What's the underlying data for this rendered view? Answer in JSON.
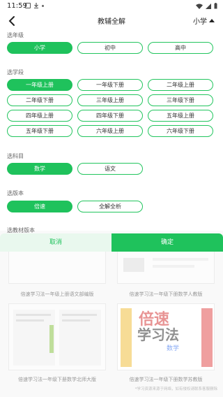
{
  "status_bar": {
    "time": "11:59"
  },
  "header": {
    "title": "教辅全解",
    "level": "小学"
  },
  "grade_section": {
    "label": "选年级",
    "options": [
      "小学",
      "初中",
      "高中"
    ]
  },
  "term_section": {
    "label": "选学段",
    "options": [
      "一年级上册",
      "一年级下册",
      "二年级上册",
      "二年级下册",
      "三年级上册",
      "三年级下册",
      "四年级上册",
      "四年级下册",
      "五年级上册",
      "五年级下册",
      "六年级上册",
      "六年级下册"
    ]
  },
  "subject_section": {
    "label": "选科目",
    "options": [
      "数学",
      "语文"
    ]
  },
  "version_section": {
    "label": "选版本",
    "options": [
      "倍速",
      "全解全析"
    ]
  },
  "textbook_section": {
    "label": "选教材版本"
  },
  "actions": {
    "cancel": "取消",
    "confirm": "确定"
  },
  "background_books": [
    {
      "caption": "倍速学习法一年级上册语文部编版"
    },
    {
      "caption": "倍速学习法一年级下册数学人教版"
    },
    {
      "caption": "倍速学习法一年级下册数学北师大版"
    },
    {
      "caption": "倍速学习法一年级下册数学苏教版"
    }
  ],
  "cover_text": {
    "title": "倍速",
    "subtitle": "学习法",
    "subject": "数学"
  },
  "footer_note": "*学习资源来源于网络，如有侵权请联系客服删除",
  "colors": {
    "accent": "#1fc25c",
    "accent_light": "#e9f8ee"
  }
}
